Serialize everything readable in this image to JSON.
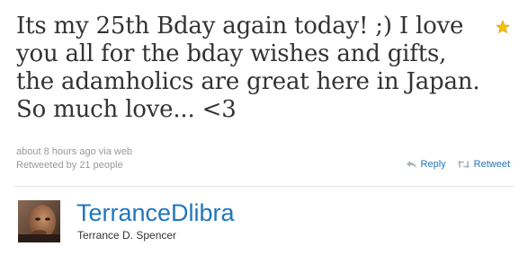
{
  "tweet": {
    "text": "Its my 25th Bday again today! ;) I love you all for the bday wishes and gifts, the adamholics are great here in Japan. So much love... <3",
    "timestamp": "about 8 hours ago",
    "via_word": "via",
    "source": "web",
    "retweeted_by": "Retweeted by 21 people"
  },
  "actions": {
    "reply_label": "Reply",
    "retweet_label": "Retweet",
    "reply_icon": "reply-arrow-icon",
    "retweet_icon": "retweet-arrows-icon",
    "favorite_icon": "star-icon"
  },
  "author": {
    "screen_name": "TerranceDlibra",
    "full_name": "Terrance D. Spencer"
  },
  "colors": {
    "link": "#2276bb",
    "text": "#333333",
    "meta": "#999999",
    "star": "#f5c400"
  }
}
